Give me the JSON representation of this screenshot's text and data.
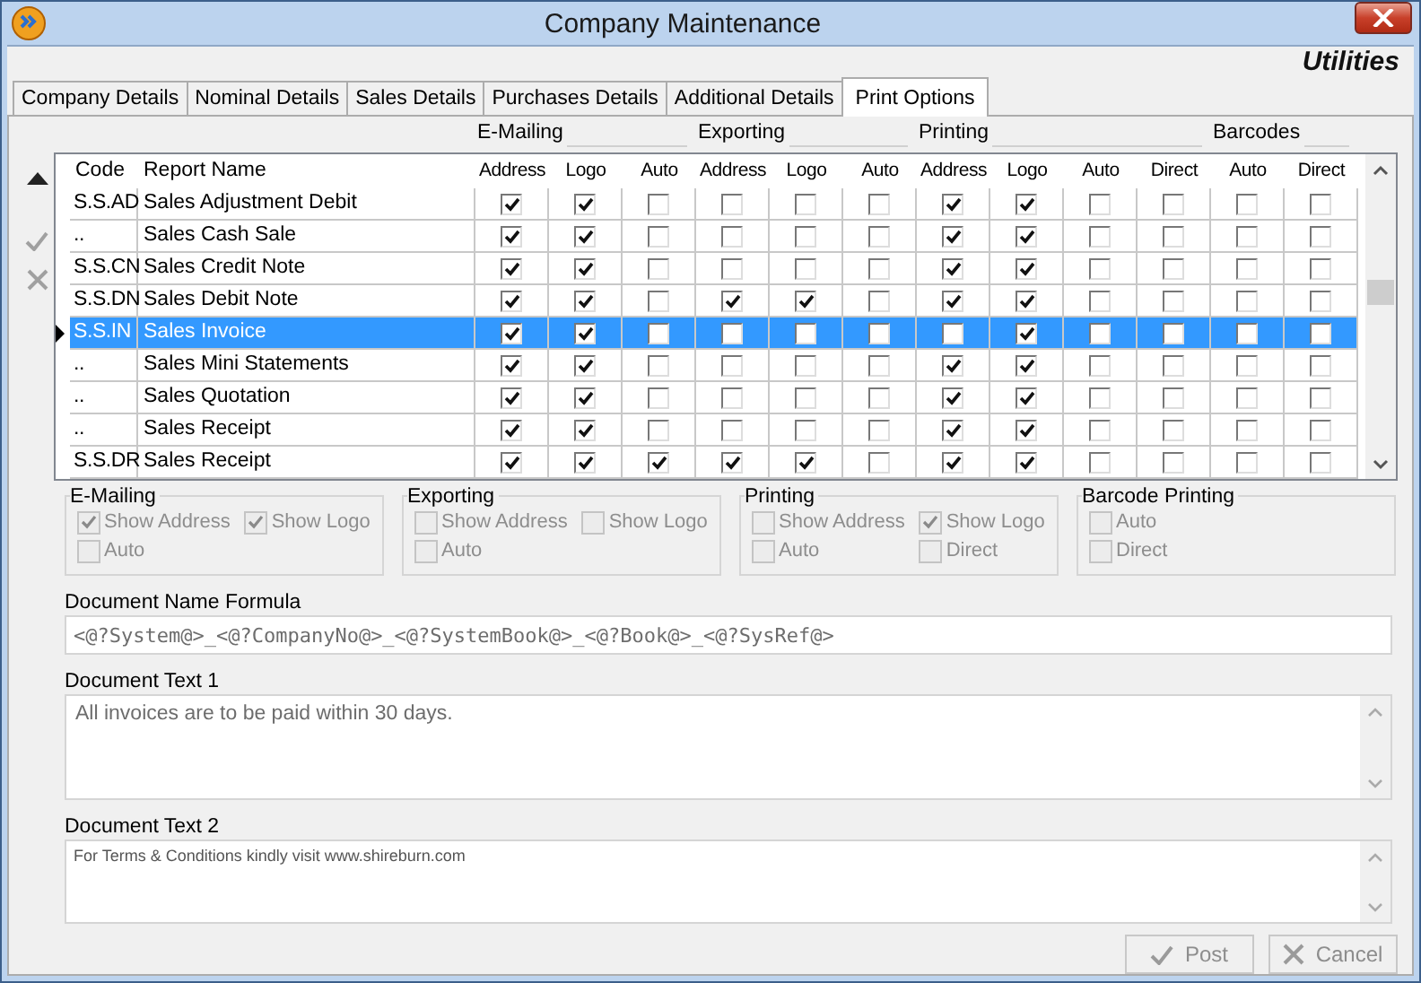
{
  "window": {
    "title": "Company Maintenance"
  },
  "header": {
    "title": "Utilities"
  },
  "tabs": [
    {
      "label": "Company Details",
      "selected": false
    },
    {
      "label": "Nominal Details",
      "selected": false
    },
    {
      "label": "Sales Details",
      "selected": false
    },
    {
      "label": "Purchases Details",
      "selected": false
    },
    {
      "label": "Additional Details",
      "selected": false
    },
    {
      "label": "Print Options",
      "selected": true
    }
  ],
  "grid": {
    "code_header": "Code",
    "name_header": "Report Name",
    "column_groups": [
      {
        "label": "E-Mailing",
        "columns": [
          "Address",
          "Logo",
          "Auto"
        ]
      },
      {
        "label": "Exporting",
        "columns": [
          "Address",
          "Logo",
          "Auto"
        ]
      },
      {
        "label": "Printing",
        "columns": [
          "Address",
          "Logo",
          "Auto",
          "Direct"
        ]
      },
      {
        "label": "Barcodes",
        "columns": [
          "Auto",
          "Direct"
        ]
      }
    ],
    "rows": [
      {
        "code": "S.S.AD",
        "report_name": "Sales Adjustment Debit",
        "selected": false,
        "checks": [
          true,
          true,
          false,
          false,
          false,
          false,
          true,
          true,
          false,
          false,
          false,
          false
        ]
      },
      {
        "code": "..",
        "report_name": "Sales Cash Sale",
        "selected": false,
        "checks": [
          true,
          true,
          false,
          false,
          false,
          false,
          true,
          true,
          false,
          false,
          false,
          false
        ]
      },
      {
        "code": "S.S.CN",
        "report_name": "Sales Credit Note",
        "selected": false,
        "checks": [
          true,
          true,
          false,
          false,
          false,
          false,
          true,
          true,
          false,
          false,
          false,
          false
        ]
      },
      {
        "code": "S.S.DN",
        "report_name": "Sales Debit Note",
        "selected": false,
        "checks": [
          true,
          true,
          false,
          true,
          true,
          false,
          true,
          true,
          false,
          false,
          false,
          false
        ]
      },
      {
        "code": "S.S.IN",
        "report_name": "Sales Invoice",
        "selected": true,
        "checks": [
          true,
          true,
          false,
          false,
          false,
          false,
          false,
          true,
          false,
          false,
          false,
          false
        ]
      },
      {
        "code": "..",
        "report_name": "Sales Mini Statements",
        "selected": false,
        "checks": [
          true,
          true,
          false,
          false,
          false,
          false,
          true,
          true,
          false,
          false,
          false,
          false
        ]
      },
      {
        "code": "..",
        "report_name": "Sales Quotation",
        "selected": false,
        "checks": [
          true,
          true,
          false,
          false,
          false,
          false,
          true,
          true,
          false,
          false,
          false,
          false
        ]
      },
      {
        "code": "..",
        "report_name": "Sales Receipt",
        "selected": false,
        "checks": [
          true,
          true,
          false,
          false,
          false,
          false,
          true,
          true,
          false,
          false,
          false,
          false
        ]
      },
      {
        "code": "S.S.DR",
        "report_name": "Sales Receipt",
        "selected": false,
        "checks": [
          true,
          true,
          true,
          true,
          true,
          false,
          true,
          true,
          false,
          false,
          false,
          false
        ]
      }
    ]
  },
  "options": [
    {
      "title": "E-Mailing",
      "rows": [
        [
          {
            "label": "Show Address",
            "checked": true,
            "disabled": true
          },
          {
            "label": "Show Logo",
            "checked": true,
            "disabled": true
          }
        ],
        [
          {
            "label": "Auto",
            "checked": false,
            "disabled": true
          }
        ]
      ]
    },
    {
      "title": "Exporting",
      "rows": [
        [
          {
            "label": "Show Address",
            "checked": false,
            "disabled": true
          },
          {
            "label": "Show Logo",
            "checked": false,
            "disabled": true
          }
        ],
        [
          {
            "label": "Auto",
            "checked": false,
            "disabled": true
          }
        ]
      ]
    },
    {
      "title": "Printing",
      "rows": [
        [
          {
            "label": "Show Address",
            "checked": false,
            "disabled": true
          },
          {
            "label": "Show Logo",
            "checked": true,
            "disabled": true
          }
        ],
        [
          {
            "label": "Auto",
            "checked": false,
            "disabled": true
          },
          {
            "label": "Direct",
            "checked": false,
            "disabled": true
          }
        ]
      ]
    },
    {
      "title": "Barcode Printing",
      "rows": [
        [
          {
            "label": "Auto",
            "checked": false,
            "disabled": true
          }
        ],
        [
          {
            "label": "Direct",
            "checked": false,
            "disabled": true
          }
        ]
      ]
    }
  ],
  "document_name_formula": {
    "label": "Document Name Formula",
    "value": "<@?System@>_<@?CompanyNo@>_<@?SystemBook@>_<@?Book@>_<@?SysRef@>"
  },
  "document_text_1": {
    "label": "Document Text 1",
    "value": "All invoices are to be paid within 30 days."
  },
  "document_text_2": {
    "label": "Document Text 2",
    "value": "For Terms & Conditions kindly visit www.shireburn.com"
  },
  "buttons": [
    {
      "label": "Post",
      "kind": "post",
      "disabled": true
    },
    {
      "label": "Cancel",
      "kind": "cancel",
      "disabled": true
    }
  ]
}
